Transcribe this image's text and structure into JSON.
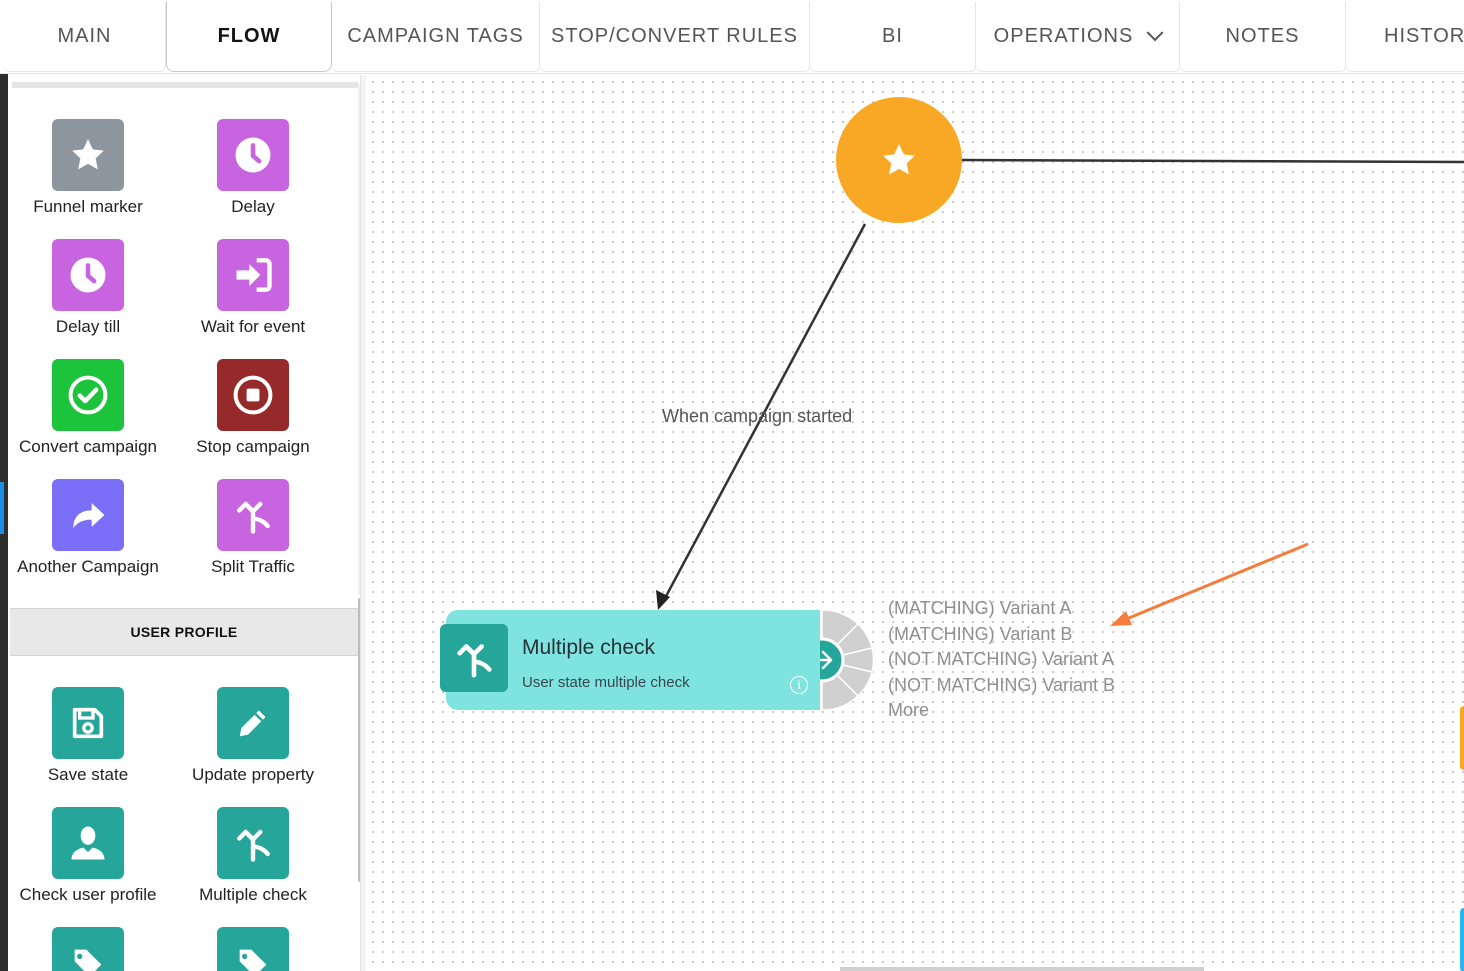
{
  "tabs": [
    {
      "label": "MAIN"
    },
    {
      "label": "FLOW"
    },
    {
      "label": "CAMPAIGN TAGS"
    },
    {
      "label": "STOP/CONVERT RULES"
    },
    {
      "label": "BI"
    },
    {
      "label": "OPERATIONS"
    },
    {
      "label": "NOTES"
    },
    {
      "label": "HISTORY"
    }
  ],
  "active_tab": "FLOW",
  "sidebar": {
    "tools": [
      {
        "label": "Funnel marker",
        "icon": "star-icon",
        "color": "#8d969e"
      },
      {
        "label": "Delay",
        "icon": "clock-icon",
        "color": "#c964e0"
      },
      {
        "label": "Delay till",
        "icon": "clock-icon",
        "color": "#c964e0"
      },
      {
        "label": "Wait for event",
        "icon": "enter-icon",
        "color": "#c964e0"
      },
      {
        "label": "Convert campaign",
        "icon": "check-circle-icon",
        "color": "#1cc43c"
      },
      {
        "label": "Stop campaign",
        "icon": "stop-circle-icon",
        "color": "#962a2a"
      },
      {
        "label": "Another Campaign",
        "icon": "redirect-arrow-icon",
        "color": "#7a6ef7"
      },
      {
        "label": "Split Traffic",
        "icon": "split-arrow-icon",
        "color": "#c964e0"
      }
    ],
    "section_title": "USER PROFILE",
    "profile_tools": [
      {
        "label": "Save state",
        "icon": "floppy-icon",
        "color": "#26a69a"
      },
      {
        "label": "Update property",
        "icon": "pencil-icon",
        "color": "#26a69a"
      },
      {
        "label": "Check user profile",
        "icon": "user-icon",
        "color": "#26a69a"
      },
      {
        "label": "Multiple check",
        "icon": "split-arrow-icon",
        "color": "#26a69a"
      },
      {
        "label": "",
        "icon": "tags-icon",
        "color": "#26a69a"
      },
      {
        "label": "",
        "icon": "tag-icon",
        "color": "#26a69a"
      }
    ]
  },
  "canvas": {
    "start_node_icon": "star-icon",
    "start_node_color": "#f9a825",
    "edge_label": "When campaign started",
    "node": {
      "title": "Multiple check",
      "subtitle": "User state multiple check",
      "icon": "split-arrow-icon",
      "info": "i"
    },
    "outputs": [
      "(MATCHING) Variant A",
      "(MATCHING) Variant B",
      "(NOT MATCHING) Variant A",
      "(NOT MATCHING) Variant B",
      "More"
    ],
    "annotation_arrow_color": "#f47c3c"
  }
}
